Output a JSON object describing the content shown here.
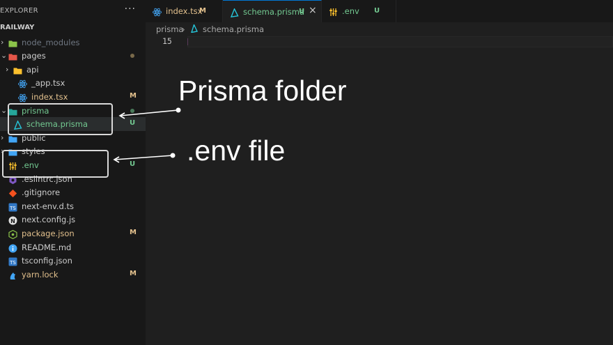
{
  "sidebar": {
    "title": "EXPLORER",
    "more": "···",
    "root": "RAILWAY",
    "items": [
      {
        "label": "node_modules",
        "badge": "",
        "dot": false,
        "status": "dim",
        "icon": "node-modules-folder-icon",
        "iconColor": "#8bc34a",
        "chevron": "›",
        "level": 0
      },
      {
        "label": "pages",
        "badge": "",
        "dot": true,
        "status": "normal",
        "icon": "pages-folder-icon",
        "iconColor": "#e45649",
        "chevron": "⌄",
        "level": 0
      },
      {
        "label": "api",
        "badge": "",
        "dot": false,
        "status": "normal",
        "icon": "api-folder-icon",
        "iconColor": "#fbc02d",
        "chevron": "›",
        "level": 1
      },
      {
        "label": "_app.tsx",
        "badge": "",
        "dot": false,
        "status": "normal",
        "icon": "react-icon",
        "iconColor": "#42a5f5",
        "chevron": "",
        "level": 2
      },
      {
        "label": "index.tsx",
        "badge": "M",
        "dot": false,
        "status": "mod",
        "icon": "react-icon",
        "iconColor": "#42a5f5",
        "chevron": "",
        "level": 2
      },
      {
        "label": "prisma",
        "badge": "",
        "dot": true,
        "status": "new",
        "icon": "prisma-folder-icon",
        "iconColor": "#26a69a",
        "chevron": "⌄",
        "level": 0
      },
      {
        "label": "schema.prisma",
        "badge": "U",
        "dot": false,
        "status": "new",
        "icon": "prisma-icon",
        "iconColor": "#26c6da",
        "chevron": "",
        "level": 1
      },
      {
        "label": "public",
        "badge": "",
        "dot": false,
        "status": "normal",
        "icon": "public-folder-icon",
        "iconColor": "#42a5f5",
        "chevron": "›",
        "level": 0
      },
      {
        "label": "styles",
        "badge": "",
        "dot": false,
        "status": "normal",
        "icon": "styles-folder-icon",
        "iconColor": "#42a5f5",
        "chevron": "›",
        "level": 0
      },
      {
        "label": ".env",
        "badge": "U",
        "dot": false,
        "status": "new",
        "icon": "env-settings-icon",
        "iconColor": "#fbc02d",
        "chevron": "",
        "level": 0
      },
      {
        "label": ".eslintrc.json",
        "badge": "",
        "dot": false,
        "status": "normal",
        "icon": "eslint-icon",
        "iconColor": "#7e57c2",
        "chevron": "",
        "level": 0
      },
      {
        "label": ".gitignore",
        "badge": "",
        "dot": false,
        "status": "normal",
        "icon": "git-icon",
        "iconColor": "#f4511e",
        "chevron": "",
        "level": 0
      },
      {
        "label": "next-env.d.ts",
        "badge": "",
        "dot": false,
        "status": "normal",
        "icon": "typescript-def-icon",
        "iconColor": "#3178c6",
        "chevron": "",
        "level": 0
      },
      {
        "label": "next.config.js",
        "badge": "",
        "dot": false,
        "status": "normal",
        "icon": "nextjs-icon",
        "iconColor": "#e0e0e0",
        "chevron": "",
        "level": 0
      },
      {
        "label": "package.json",
        "badge": "M",
        "dot": false,
        "status": "mod",
        "icon": "nodejs-icon",
        "iconColor": "#8bc34a",
        "chevron": "",
        "level": 0
      },
      {
        "label": "README.md",
        "badge": "",
        "dot": false,
        "status": "normal",
        "icon": "info-icon",
        "iconColor": "#42a5f5",
        "chevron": "",
        "level": 0
      },
      {
        "label": "tsconfig.json",
        "badge": "",
        "dot": false,
        "status": "normal",
        "icon": "tsconfig-icon",
        "iconColor": "#3178c6",
        "chevron": "",
        "level": 0
      },
      {
        "label": "yarn.lock",
        "badge": "M",
        "dot": false,
        "status": "mod",
        "icon": "yarn-icon",
        "iconColor": "#42a5f5",
        "chevron": "",
        "level": 0
      }
    ]
  },
  "tabs": [
    {
      "label": "index.tsx",
      "badge": "M",
      "status": "mod",
      "icon": "react-icon",
      "iconColor": "#42a5f5",
      "active": false,
      "close": ""
    },
    {
      "label": "schema.prisma",
      "badge": "U",
      "status": "new",
      "icon": "prisma-icon",
      "iconColor": "#26c6da",
      "active": true,
      "close": "×"
    },
    {
      "label": ".env",
      "badge": "U",
      "status": "new",
      "icon": "env-settings-icon",
      "iconColor": "#fbc02d",
      "active": false,
      "close": ""
    }
  ],
  "breadcrumb": {
    "folder": "prisma",
    "sep": "›",
    "file": "schema.prisma"
  },
  "editor": {
    "line_number": "15"
  },
  "annotations": {
    "prisma": "Prisma folder",
    "env": ".env file"
  },
  "colors": {
    "modified": "#e2c08d",
    "untracked": "#73c991",
    "accent": "#0078d4"
  }
}
